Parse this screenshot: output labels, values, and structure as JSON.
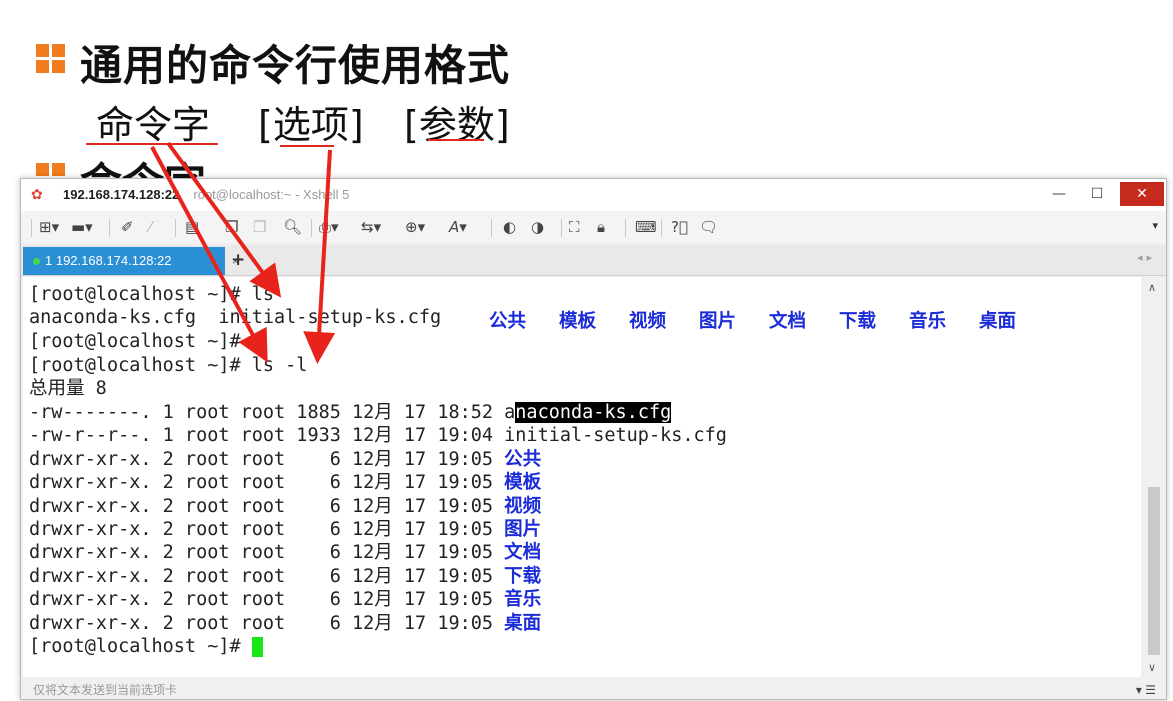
{
  "slide": {
    "title": "通用的命令行使用格式",
    "syntax_command": "命令字",
    "syntax_options": "[选项]",
    "syntax_params": "[参数]",
    "partial_next_heading": "命令字",
    "accent_color": "#f07c1e",
    "underline_color": "#e0281f"
  },
  "window": {
    "title_ip": "192.168.174.128:22",
    "title_rest": "root@localhost:~ - Xshell 5",
    "minimize": "—",
    "maximize": "☐",
    "close": "✕"
  },
  "tabs": [
    {
      "label": "1 192.168.174.128:22",
      "close": "×",
      "active": true
    }
  ],
  "tab_add": "+",
  "terminal": {
    "prompt1": "[root@localhost ~]# ls",
    "ls_files": "anaconda-ks.cfg  initial-setup-ks.cfg",
    "ls_dirs": [
      "公共",
      "模板",
      "视频",
      "图片",
      "文档",
      "下载",
      "音乐",
      "桌面"
    ],
    "prompt2": "[root@localhost ~]#",
    "prompt3": "[root@localhost ~]# ls -l",
    "total": "总用量 8",
    "file_rows": [
      {
        "meta": "-rw-------. 1 root root 1885 12月 17 18:52 ",
        "name_prefix": "a",
        "name_hl": "naconda-ks.cfg"
      },
      {
        "meta": "-rw-r--r--. 1 root root 1933 12月 17 19:04 ",
        "name": "initial-setup-ks.cfg"
      }
    ],
    "dir_rows": [
      {
        "meta": "drwxr-xr-x. 2 root root    6 12月 17 19:05 ",
        "name": "公共"
      },
      {
        "meta": "drwxr-xr-x. 2 root root    6 12月 17 19:05 ",
        "name": "模板"
      },
      {
        "meta": "drwxr-xr-x. 2 root root    6 12月 17 19:05 ",
        "name": "视频"
      },
      {
        "meta": "drwxr-xr-x. 2 root root    6 12月 17 19:05 ",
        "name": "图片"
      },
      {
        "meta": "drwxr-xr-x. 2 root root    6 12月 17 19:05 ",
        "name": "文档"
      },
      {
        "meta": "drwxr-xr-x. 2 root root    6 12月 17 19:05 ",
        "name": "下载"
      },
      {
        "meta": "drwxr-xr-x. 2 root root    6 12月 17 19:05 ",
        "name": "音乐"
      },
      {
        "meta": "drwxr-xr-x. 2 root root    6 12月 17 19:05 ",
        "name": "桌面"
      }
    ],
    "final_prompt": "[root@localhost ~]# ",
    "dir_color": "#1c2cd6",
    "cursor_color": "#19e619"
  },
  "statusbar": {
    "text": "仅将文本发送到当前选项卡",
    "controls": "▾  ☰"
  },
  "toolbar_icons": [
    "new-session-icon",
    "open-icon",
    "disconnect-icon",
    "copy-icon",
    "paste-icon",
    "find-icon",
    "print-icon",
    "transfer-icon",
    "globe-icon",
    "font-icon",
    "xftp-icon",
    "script-icon",
    "fullscreen-icon",
    "lock-icon",
    "keyboard-icon",
    "help-icon",
    "chat-icon"
  ],
  "annotation_color": "#e8231b"
}
